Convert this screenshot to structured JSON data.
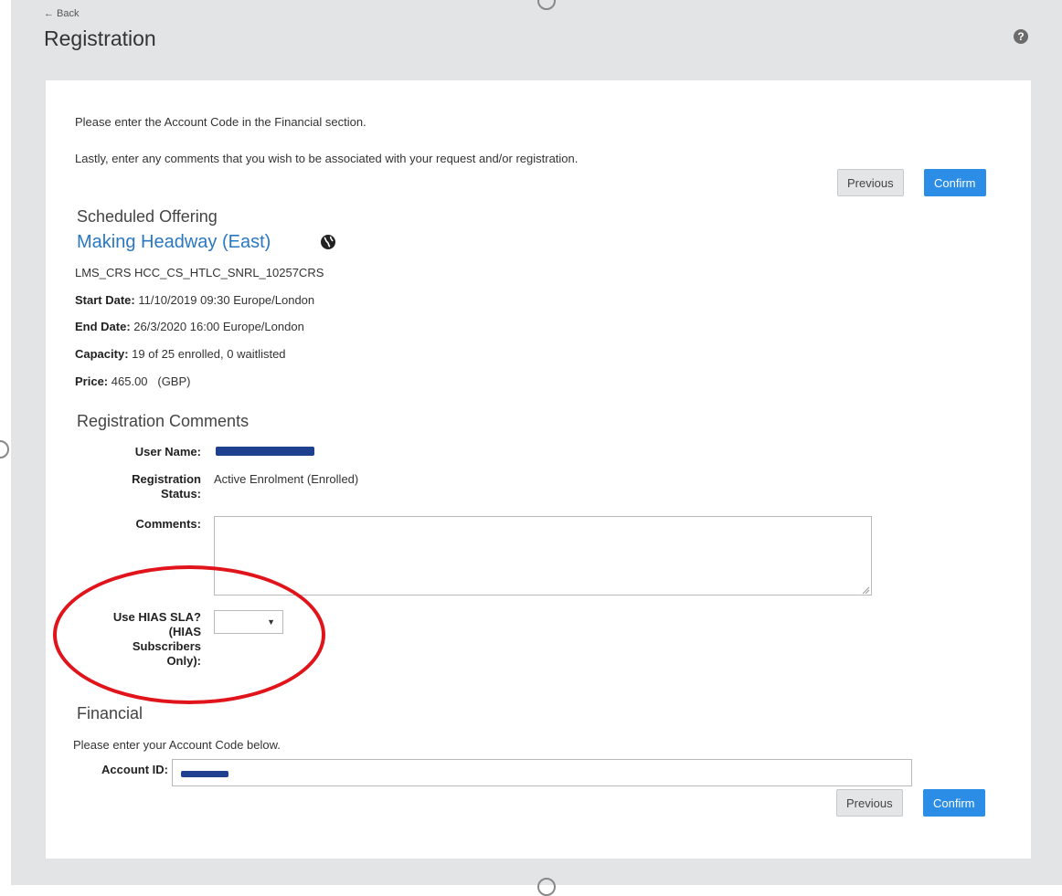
{
  "header": {
    "back_label": "← Back",
    "title": "Registration",
    "help_icon": "question-circle-icon"
  },
  "intro": {
    "line1": "Please enter the Account Code in the Financial section.",
    "line2": "Lastly, enter any comments that you wish to be associated with your request and/or registration."
  },
  "buttons": {
    "previous": "Previous",
    "confirm": "Confirm"
  },
  "offering": {
    "heading": "Scheduled Offering",
    "title": "Making Headway (East)",
    "globe_icon": "globe-icon",
    "code": "LMS_CRS HCC_CS_HTLC_SNRL_10257CRS",
    "start_label": "Start Date:",
    "start_value": "11/10/2019 09:30 Europe/London",
    "end_label": "End Date:",
    "end_value": "26/3/2020 16:00 Europe/London",
    "capacity_label": "Capacity:",
    "capacity_value": "19 of 25 enrolled, 0 waitlisted",
    "price_label": "Price:",
    "price_value": "465.00   (GBP)"
  },
  "comments_section": {
    "heading": "Registration Comments",
    "user_name_label": "User Name:",
    "status_label_1": "Registration",
    "status_label_2": "Status:",
    "status_value": "Active Enrolment (Enrolled)",
    "comments_label": "Comments:",
    "comments_value": "",
    "hias_label_1": "Use HIAS SLA?",
    "hias_label_2": "(HIAS",
    "hias_label_3": "Subscribers",
    "hias_label_4": "Only):",
    "hias_selected": ""
  },
  "financial": {
    "heading": "Financial",
    "instruction": "Please enter your Account Code below.",
    "account_label": "Account ID:"
  },
  "colors": {
    "accent": "#2b8de6",
    "link": "#2a78c2",
    "annotation": "#e0141a",
    "redaction": "#1f3f8f"
  }
}
